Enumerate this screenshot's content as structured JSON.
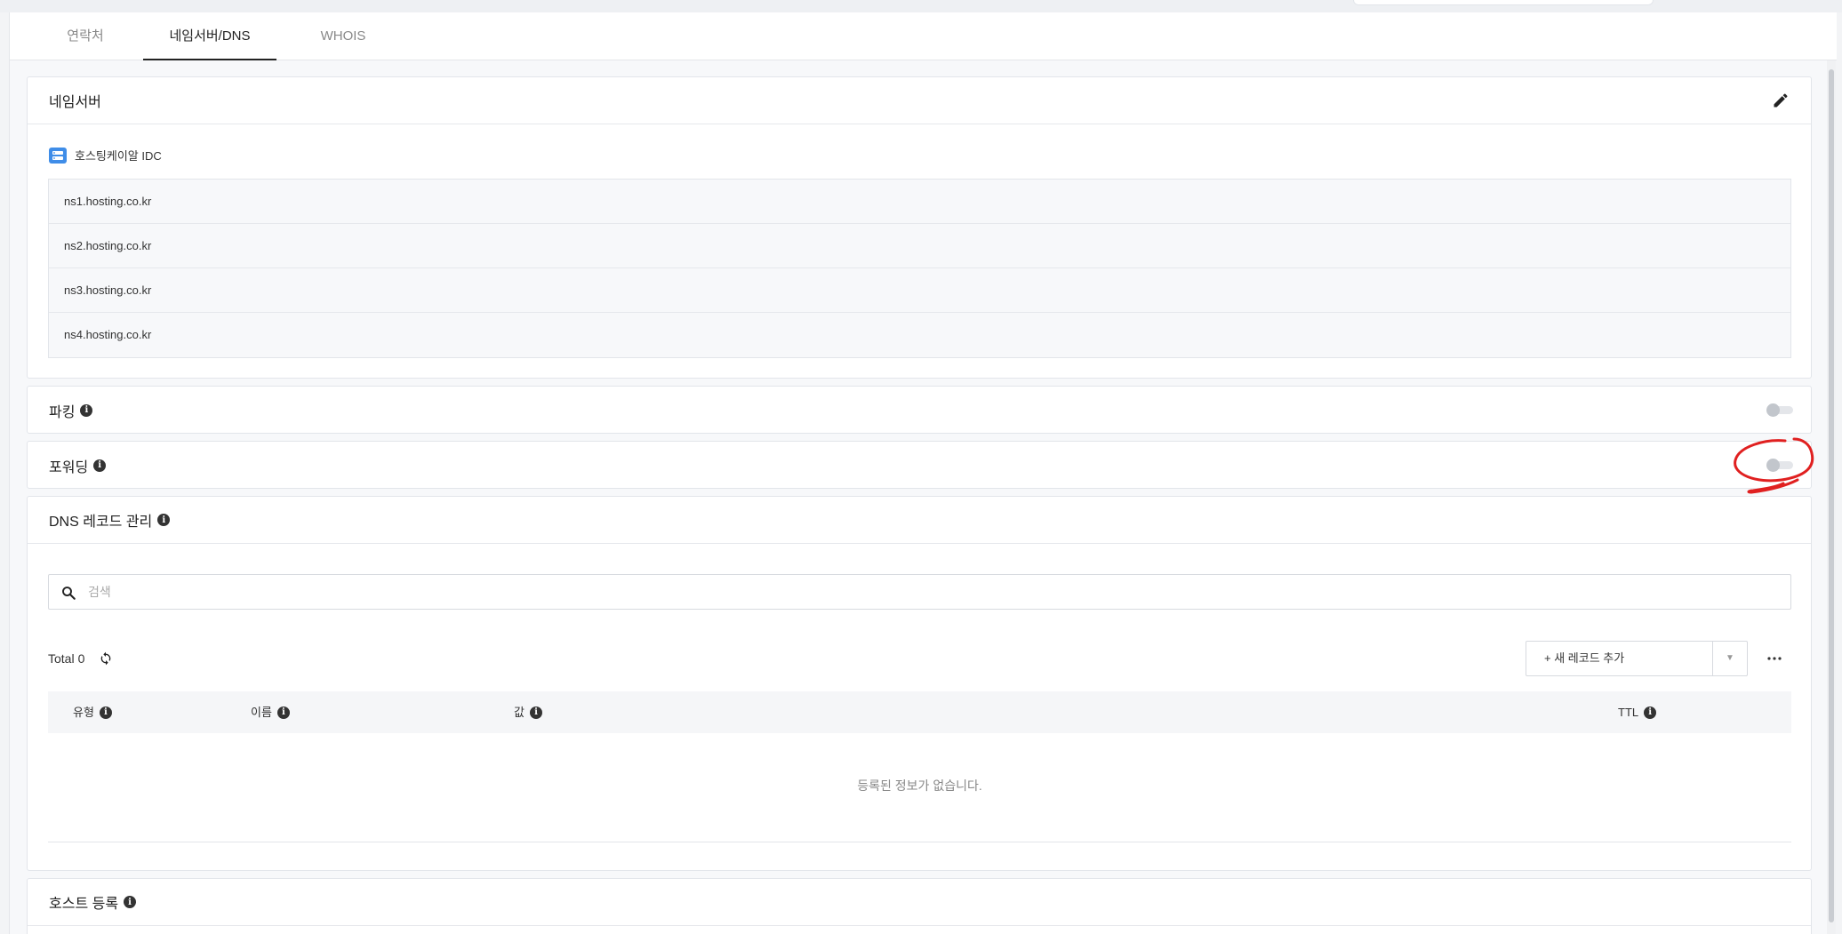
{
  "tabs": [
    {
      "label": "연락처",
      "active": false
    },
    {
      "label": "네임서버/DNS",
      "active": true
    },
    {
      "label": "WHOIS",
      "active": false
    }
  ],
  "nameserver": {
    "title": "네임서버",
    "provider": "호스팅케이알 IDC",
    "servers": [
      "ns1.hosting.co.kr",
      "ns2.hosting.co.kr",
      "ns3.hosting.co.kr",
      "ns4.hosting.co.kr"
    ]
  },
  "parking": {
    "title": "파킹",
    "enabled": false
  },
  "forwarding": {
    "title": "포워딩",
    "enabled": false
  },
  "dns": {
    "title": "DNS 레코드 관리",
    "search_placeholder": "검색",
    "total_label": "Total",
    "total_count": "0",
    "add_record_label": "+ 새 레코드 추가",
    "columns": [
      "유형",
      "이름",
      "값",
      "TTL"
    ],
    "empty_message": "등록된 정보가 없습니다."
  },
  "host": {
    "title": "호스트 등록"
  },
  "colors": {
    "accent": "#222222",
    "annotation": "#e02020",
    "server_icon": "#3f8de8"
  }
}
